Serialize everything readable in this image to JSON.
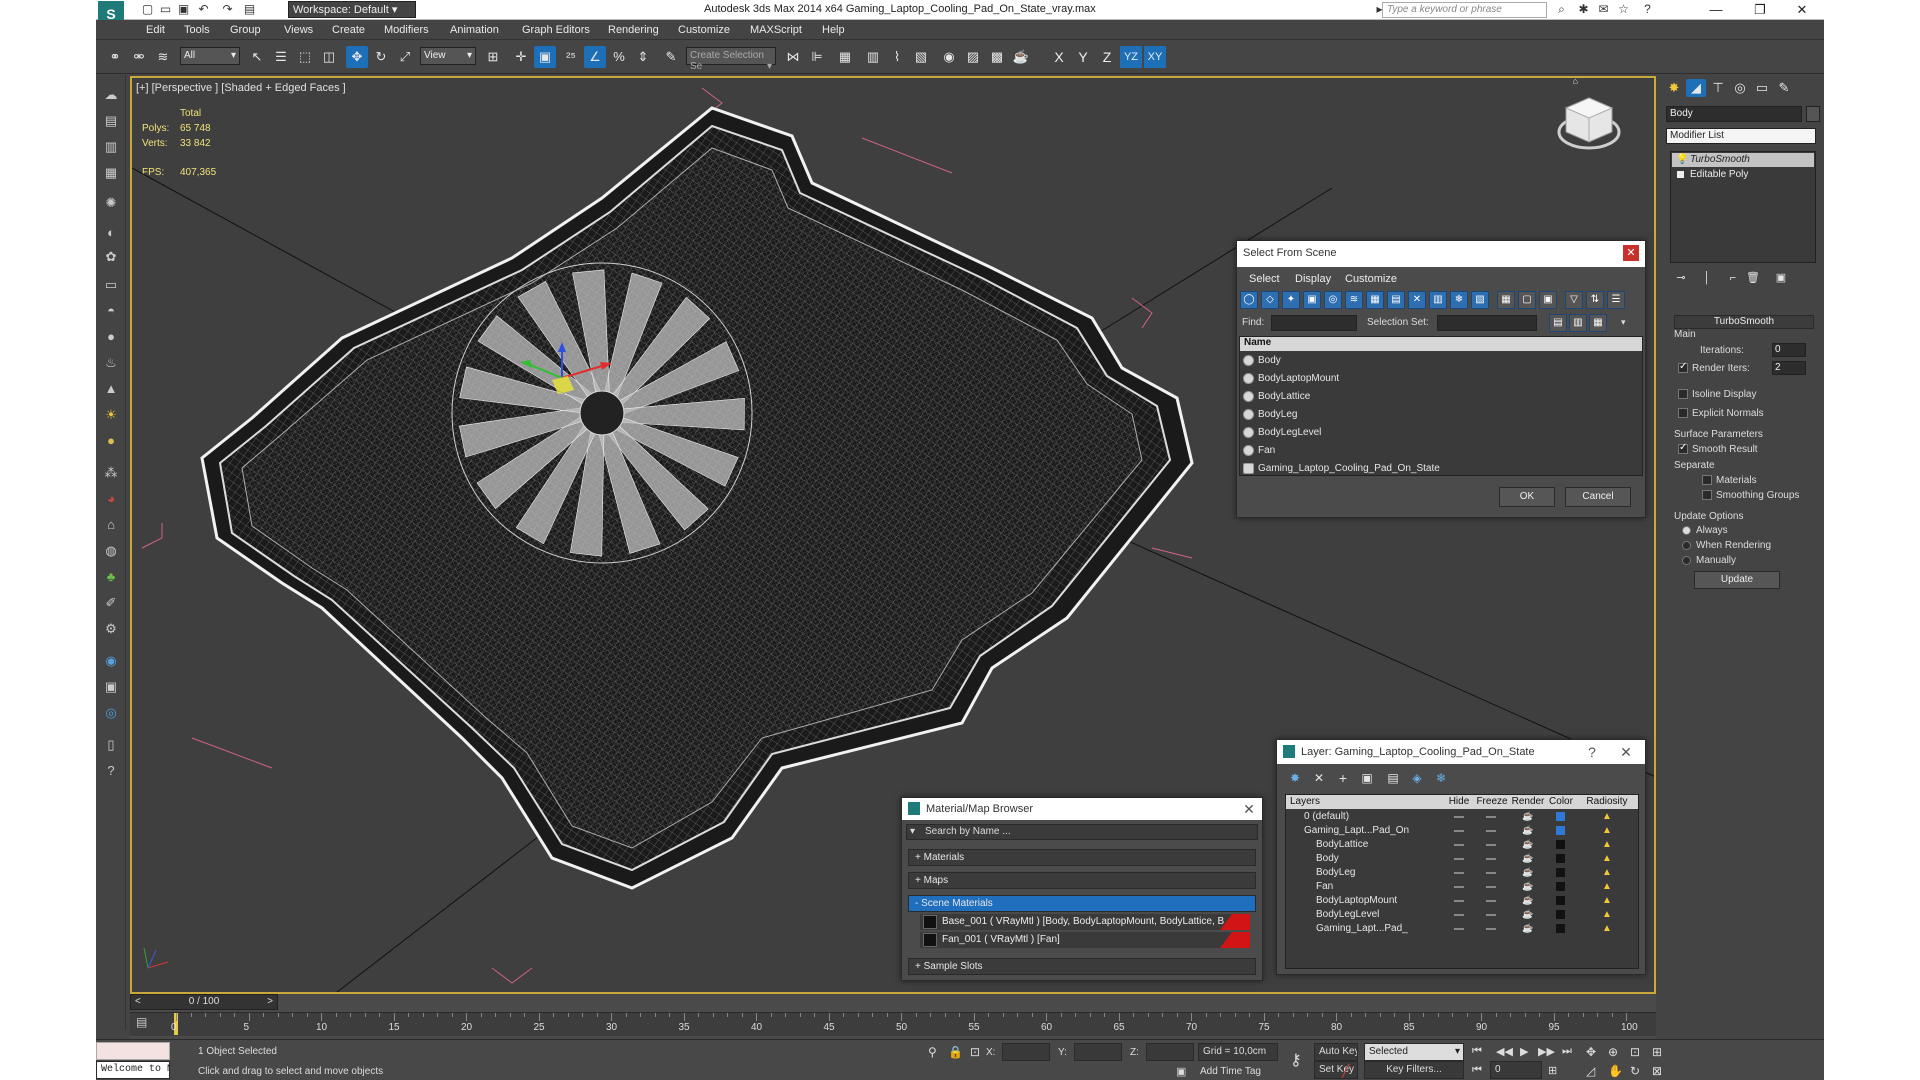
{
  "titlebar": {
    "workspace": "Workspace: Default",
    "title": "Autodesk 3ds Max  2014 x64     Gaming_Laptop_Cooling_Pad_On_State_vray.max",
    "search_placeholder": "Type a keyword or phrase"
  },
  "menu": [
    "Edit",
    "Tools",
    "Group",
    "Views",
    "Create",
    "Modifiers",
    "Animation",
    "Graph Editors",
    "Rendering",
    "Customize",
    "MAXScript",
    "Help"
  ],
  "toolbar": {
    "filter": "All",
    "refcoord": "View",
    "selection_set": "Create Selection Se",
    "axes": [
      "X",
      "Y",
      "Z",
      "YZ",
      "XY"
    ]
  },
  "viewport": {
    "label": "[+] [Perspective ] [Shaded + Edged Faces ]",
    "stats": {
      "total_label": "Total",
      "polys_label": "Polys:",
      "polys": "65 748",
      "verts_label": "Verts:",
      "verts": "33 842",
      "fps_label": "FPS:",
      "fps": "407,365"
    }
  },
  "select_from_scene": {
    "title": "Select From Scene",
    "menu": [
      "Select",
      "Display",
      "Customize"
    ],
    "find_label": "Find:",
    "selection_set_label": "Selection Set:",
    "column_name": "Name",
    "items": [
      "Body",
      "BodyLaptopMount",
      "BodyLattice",
      "BodyLeg",
      "BodyLegLevel",
      "Fan",
      "Gaming_Laptop_Cooling_Pad_On_State"
    ],
    "ok": "OK",
    "cancel": "Cancel"
  },
  "command_panel": {
    "object_name": "Body",
    "modifier_list": "Modifier List",
    "stack": [
      "TurboSmooth",
      "Editable Poly"
    ],
    "rollout": "TurboSmooth",
    "main": "Main",
    "iterations_label": "Iterations:",
    "iterations": "0",
    "render_iters_label": "Render Iters:",
    "render_iters": "2",
    "isoline": "Isoline Display",
    "explicit_normals": "Explicit Normals",
    "surface_params": "Surface Parameters",
    "smooth_result": "Smooth Result",
    "separate": "Separate",
    "materials": "Materials",
    "smoothing_groups": "Smoothing Groups",
    "update_options": "Update Options",
    "always": "Always",
    "when_rendering": "When Rendering",
    "manually": "Manually",
    "update": "Update"
  },
  "material_browser": {
    "title": "Material/Map Browser",
    "search_placeholder": "Search by Name ...",
    "groups": [
      "+ Materials",
      "+ Maps",
      "- Scene Materials",
      "+ Sample Slots"
    ],
    "materials": [
      "Base_001 ( VRayMtl ) [Body, BodyLaptopMount, BodyLattice, B...",
      "Fan_001 ( VRayMtl ) [Fan]"
    ]
  },
  "layers": {
    "title": "Layer: Gaming_Laptop_Cooling_Pad_On_State",
    "help": "?",
    "columns": [
      "Layers",
      "Hide",
      "Freeze",
      "Render",
      "Color",
      "Radiosity"
    ],
    "rows": [
      {
        "name": "0 (default)",
        "indent": 1,
        "color": "#2f79d6"
      },
      {
        "name": "Gaming_Lapt...Pad_On",
        "indent": 1,
        "color": "#2f79d6"
      },
      {
        "name": "BodyLattice",
        "indent": 2,
        "color": "#111111"
      },
      {
        "name": "Body",
        "indent": 2,
        "color": "#111111"
      },
      {
        "name": "BodyLeg",
        "indent": 2,
        "color": "#111111"
      },
      {
        "name": "Fan",
        "indent": 2,
        "color": "#111111"
      },
      {
        "name": "BodyLaptopMount",
        "indent": 2,
        "color": "#111111"
      },
      {
        "name": "BodyLegLevel",
        "indent": 2,
        "color": "#111111"
      },
      {
        "name": "Gaming_Lapt...Pad_",
        "indent": 2,
        "color": "#111111"
      }
    ]
  },
  "timeline": {
    "frame": "0 / 100",
    "prev": "<",
    "next": ">",
    "ticks": [
      "0",
      "5",
      "10",
      "15",
      "20",
      "25",
      "30",
      "35",
      "40",
      "45",
      "50",
      "55",
      "60",
      "65",
      "70",
      "75",
      "80",
      "85",
      "90",
      "95",
      "100"
    ]
  },
  "status": {
    "maxscript": "Welcome to M",
    "selected": "1 Object Selected",
    "prompt": "Click and drag to select and move objects",
    "x_label": "X:",
    "y_label": "Y:",
    "z_label": "Z:",
    "grid": "Grid = 10,0cm",
    "add_time_tag": "Add Time Tag",
    "auto_key": "Auto Key",
    "set_key": "Set Key",
    "key_mode": "Selected",
    "key_filters": "Key Filters...",
    "frame": "0"
  }
}
